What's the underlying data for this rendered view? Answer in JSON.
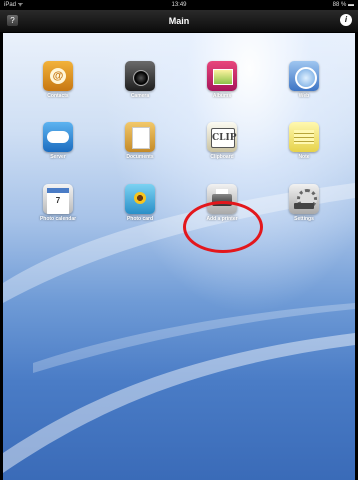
{
  "status_bar": {
    "left": "iPad ᯤ",
    "time": "13:49",
    "right": "88 % ▬"
  },
  "nav": {
    "title": "Main",
    "left_icon": "help-book-icon",
    "right_icon": "info-icon"
  },
  "apps": [
    {
      "label": "Contacts",
      "icon": "contacts-icon"
    },
    {
      "label": "Camera",
      "icon": "camera-icon"
    },
    {
      "label": "Albums",
      "icon": "albums-icon"
    },
    {
      "label": "Web",
      "icon": "web-icon"
    },
    {
      "label": "Server",
      "icon": "server-icon"
    },
    {
      "label": "Documents",
      "icon": "documents-icon"
    },
    {
      "label": "Clipboard",
      "icon": "clipboard-icon",
      "glyph": "CLIP"
    },
    {
      "label": "Note",
      "icon": "note-icon"
    },
    {
      "label": "Photo calendar",
      "icon": "photo-calendar-icon",
      "glyph": "7"
    },
    {
      "label": "Photo card",
      "icon": "photo-card-icon"
    },
    {
      "label": "Add a printer",
      "icon": "add-printer-icon"
    },
    {
      "label": "Settings",
      "icon": "settings-icon"
    }
  ],
  "colors": {
    "nav_bg": "#111111",
    "highlight": "#e3171c",
    "wallpaper": "#4a7cc6"
  }
}
